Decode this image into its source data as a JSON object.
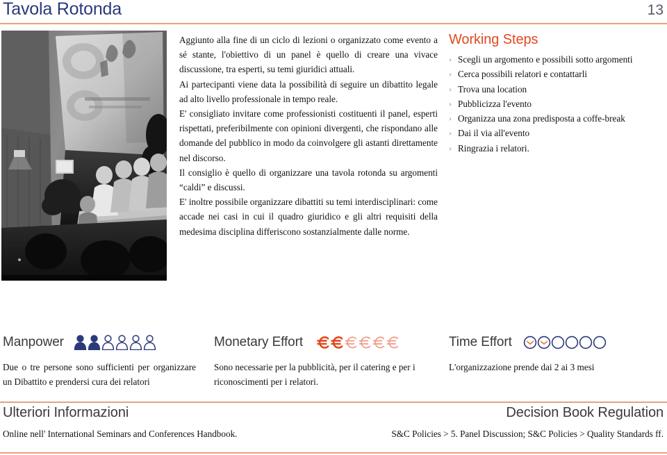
{
  "header": {
    "title": "Tavola Rotonda",
    "page_number": "13",
    "rule_color": "#e8a37c",
    "title_color": "#2b3a7a"
  },
  "photo": {
    "alt": "Black and white photograph of a panel discussion with speakers seated on a stage in front of a projection screen",
    "caption": ""
  },
  "body": {
    "paragraphs": [
      "Aggiunto alla fine di un ciclo di lezioni o organizzato come evento a sé stante, l'obiettivo di un panel è quello di creare una vivace discussione, tra esperti, su temi giuridici attuali.",
      "Ai partecipanti viene data la possibilità di seguire un dibattito legale ad alto livello professionale in tempo reale.",
      "E' consigliato invitare come professionisti costituenti il panel, esperti rispettati, preferibilmente con opinioni divergenti, che rispondano alle domande del pubblico in modo da coinvolgere gli astanti direttamente nel discorso.",
      "Il consiglio è quello di organizzare una tavola rotonda su argomenti “caldi” e discussi.",
      "E' inoltre possibile organizzare dibattiti su temi interdisciplinari: come accade nei casi in cui il quadro giuridico e gli altri requisiti della medesima disciplina differiscono sostanzialmente dalle norme."
    ]
  },
  "working_steps": {
    "title": "Working Steps",
    "title_color": "#e2491f",
    "bullet_glyph": "›",
    "items": [
      "Scegli un argomento e possibili sotto argomenti",
      "Cerca possibili relatori e contattarli",
      "Trova una location",
      "Pubblicizza l'evento",
      "Organizza una zona predisposta a coffe-break",
      "Dai il via all'evento",
      "Ringrazia i relatori."
    ]
  },
  "metrics": [
    {
      "label": "Manpower",
      "icon": "person-icon",
      "total": 6,
      "filled": 2,
      "color": "#2b3a7a",
      "description": "Due o tre persone sono sufficienti per organizzare un Dibattito e prendersi cura dei relatori"
    },
    {
      "label": "Monetary Effort",
      "icon": "euro-icon",
      "total": 6,
      "filled": 2,
      "color": "#e2491f",
      "description": "Sono necessarie per la pubblicità, per il catering e per i riconoscimenti per i relatori."
    },
    {
      "label": "Time Effort",
      "icon": "clock-icon",
      "total": 6,
      "filled": 2,
      "color": "#2b3a7a",
      "hand_color": "#e08a3c",
      "description": "L'organizzazione prende dai 2 ai 3 mesi"
    }
  ],
  "footer": {
    "left_title": "Ulteriori Informazioni",
    "left_subtitle": "Online nell' International Seminars and Conferences Handbook.",
    "right_title": "Decision Book Regulation",
    "right_subtitle": "S&C Policies > 5. Panel Discussion; S&C Policies > Quality Standards ff."
  }
}
